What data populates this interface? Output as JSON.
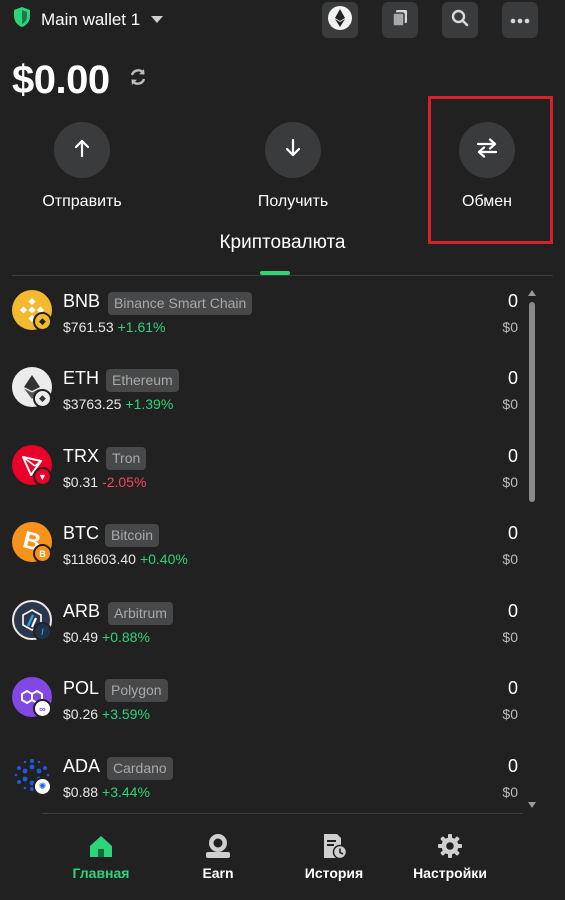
{
  "header": {
    "wallet_name": "Main wallet 1",
    "icons": [
      "shield-icon",
      "ethereum-icon",
      "copy-icon",
      "search-icon",
      "more-icon"
    ]
  },
  "balance": {
    "amount": "$0.00"
  },
  "actions": [
    {
      "label": "Отправить",
      "icon": "arrow-up-icon"
    },
    {
      "label": "Получить",
      "icon": "arrow-down-icon"
    },
    {
      "label": "Обмен",
      "icon": "swap-icon"
    }
  ],
  "tab": {
    "label": "Криптовалюта"
  },
  "assets": [
    {
      "symbol": "BNB",
      "chain": "Binance Smart Chain",
      "price": "$761.53",
      "change": "+1.61%",
      "direction": "up",
      "amount": "0",
      "fiat": "$0",
      "color": "#f3ba2f"
    },
    {
      "symbol": "ETH",
      "chain": "Ethereum",
      "price": "$3763.25",
      "change": "+1.39%",
      "direction": "up",
      "amount": "0",
      "fiat": "$0",
      "color": "#ececec"
    },
    {
      "symbol": "TRX",
      "chain": "Tron",
      "price": "$0.31",
      "change": "-2.05%",
      "direction": "down",
      "amount": "0",
      "fiat": "$0",
      "color": "#eb0029"
    },
    {
      "symbol": "BTC",
      "chain": "Bitcoin",
      "price": "$118603.40",
      "change": "+0.40%",
      "direction": "up",
      "amount": "0",
      "fiat": "$0",
      "color": "#f7931a"
    },
    {
      "symbol": "ARB",
      "chain": "Arbitrum",
      "price": "$0.49",
      "change": "+0.88%",
      "direction": "up",
      "amount": "0",
      "fiat": "$0",
      "color": "#2d374b"
    },
    {
      "symbol": "POL",
      "chain": "Polygon",
      "price": "$0.26",
      "change": "+3.59%",
      "direction": "up",
      "amount": "0",
      "fiat": "$0",
      "color": "#8247e5"
    },
    {
      "symbol": "ADA",
      "chain": "Cardano",
      "price": "$0.88",
      "change": "+3.44%",
      "direction": "up",
      "amount": "0",
      "fiat": "$0",
      "color": "#0033ad"
    }
  ],
  "nav": [
    {
      "label": "Главная",
      "icon": "home-icon",
      "active": true
    },
    {
      "label": "Earn",
      "icon": "earn-icon",
      "active": false
    },
    {
      "label": "История",
      "icon": "history-icon",
      "active": false
    },
    {
      "label": "Настройки",
      "icon": "settings-icon",
      "active": false
    }
  ],
  "colors": {
    "accent": "#2ed47a",
    "negative": "#f6465d",
    "background": "#212121",
    "highlight": "#d8202a"
  }
}
